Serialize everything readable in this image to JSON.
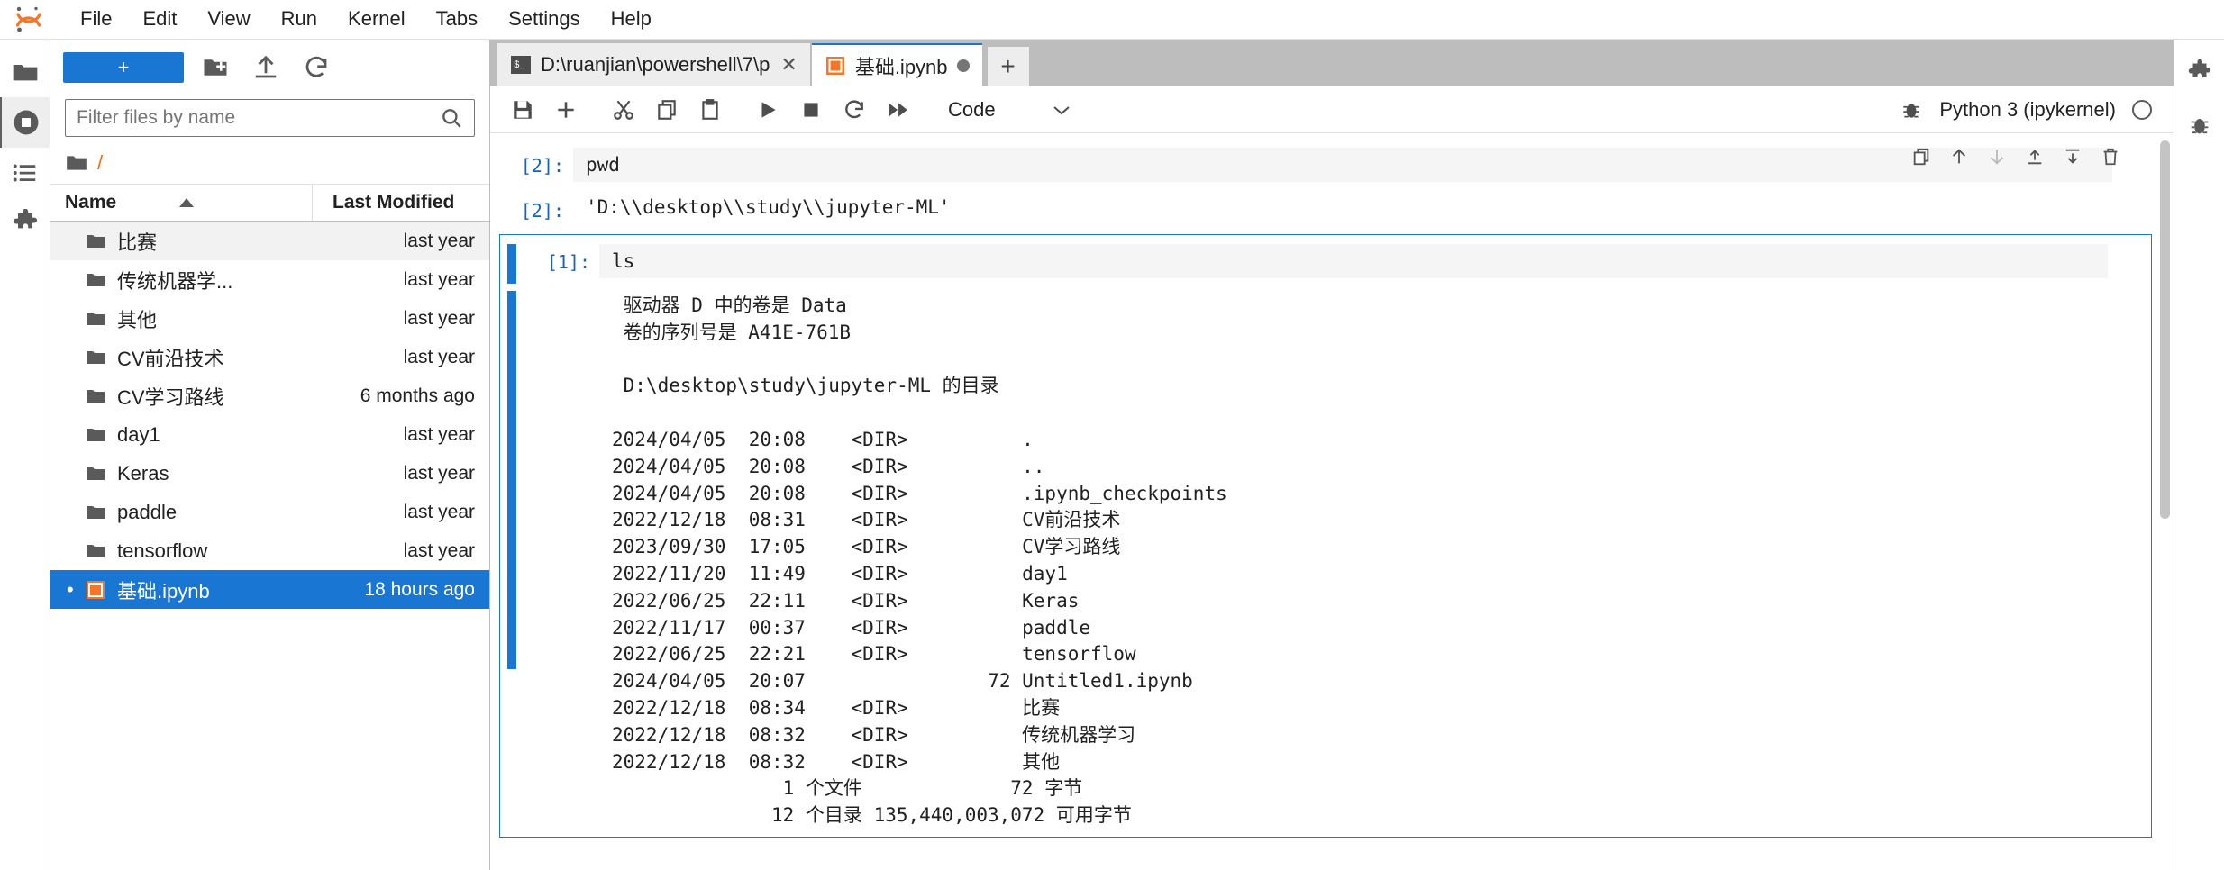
{
  "app": {
    "logo_name": "jupyter-logo",
    "menu": [
      "File",
      "Edit",
      "View",
      "Run",
      "Kernel",
      "Tabs",
      "Settings",
      "Help"
    ]
  },
  "left_activity_bar": {
    "items": [
      {
        "name": "file-browser-icon",
        "label": "File Browser"
      },
      {
        "name": "running-terminals-icon",
        "label": "Running Terminals and Kernels"
      },
      {
        "name": "table-of-contents-icon",
        "label": "Table of Contents"
      },
      {
        "name": "extension-manager-icon",
        "label": "Extension Manager"
      }
    ]
  },
  "file_browser": {
    "new_launcher_label": "+",
    "new_folder_label": "new-folder",
    "upload_label": "upload",
    "refresh_label": "refresh",
    "filter": {
      "value": "",
      "placeholder": "Filter files by name"
    },
    "breadcrumb": "/",
    "columns": {
      "name": "Name",
      "last_modified": "Last Modified"
    },
    "sort_direction": "ascending",
    "items": [
      {
        "name": "比赛",
        "type": "folder",
        "modified": "last year",
        "selected": false
      },
      {
        "name": "传统机器学...",
        "type": "folder",
        "modified": "last year",
        "selected": false
      },
      {
        "name": "其他",
        "type": "folder",
        "modified": "last year",
        "selected": false
      },
      {
        "name": "CV前沿技术",
        "type": "folder",
        "modified": "last year",
        "selected": false
      },
      {
        "name": "CV学习路线",
        "type": "folder",
        "modified": "6 months ago",
        "selected": false
      },
      {
        "name": "day1",
        "type": "folder",
        "modified": "last year",
        "selected": false
      },
      {
        "name": "Keras",
        "type": "folder",
        "modified": "last year",
        "selected": false
      },
      {
        "name": "paddle",
        "type": "folder",
        "modified": "last year",
        "selected": false
      },
      {
        "name": "tensorflow",
        "type": "folder",
        "modified": "last year",
        "selected": false
      },
      {
        "name": "基础.ipynb",
        "type": "notebook",
        "modified": "18 hours ago",
        "selected": true
      }
    ]
  },
  "tabs": [
    {
      "title": "D:\\ruanjian\\powershell\\7\\p",
      "icon": "terminal-icon",
      "active": false,
      "dirty": false,
      "closable": true
    },
    {
      "title": "基础.ipynb",
      "icon": "notebook-icon",
      "active": true,
      "dirty": true,
      "closable": false
    }
  ],
  "tab_add_label": "+",
  "notebook_toolbar": {
    "buttons": [
      {
        "name": "save-button",
        "icon": "save-icon"
      },
      {
        "name": "insert-cell-button",
        "icon": "plus-icon"
      },
      {
        "name": "cut-cell-button",
        "icon": "scissors-icon"
      },
      {
        "name": "copy-cell-button",
        "icon": "copy-icon"
      },
      {
        "name": "paste-cell-button",
        "icon": "paste-icon"
      },
      {
        "name": "run-cell-button",
        "icon": "play-icon"
      },
      {
        "name": "interrupt-kernel-button",
        "icon": "stop-icon"
      },
      {
        "name": "restart-kernel-button",
        "icon": "restart-icon"
      },
      {
        "name": "restart-and-run-all-button",
        "icon": "fast-forward-icon"
      }
    ],
    "cell_type": "Code",
    "kernel_name": "Python 3 (ipykernel)",
    "kernel_status": "idle",
    "bug_icon": "debugger-icon"
  },
  "right_activity_bar": {
    "items": [
      {
        "name": "property-inspector-icon",
        "label": "Property Inspector"
      },
      {
        "name": "debugger-icon",
        "label": "Debugger"
      }
    ]
  },
  "cells": [
    {
      "prompt": "[2]:",
      "type": "input",
      "source": "pwd",
      "selected": false
    },
    {
      "prompt": "[2]:",
      "type": "output",
      "text": "'D:\\\\desktop\\\\study\\\\jupyter-ML'",
      "selected": false
    }
  ],
  "active_cell": {
    "prompt": "[1]:",
    "source": "ls",
    "output": " 驱动器 D 中的卷是 Data\n 卷的序列号是 A41E-761B\n\n D:\\desktop\\study\\jupyter-ML 的目录\n\n2024/04/05  20:08    <DIR>          .\n2024/04/05  20:08    <DIR>          ..\n2024/04/05  20:08    <DIR>          .ipynb_checkpoints\n2022/12/18  08:31    <DIR>          CV前沿技术\n2023/09/30  17:05    <DIR>          CV学习路线\n2022/11/20  11:49    <DIR>          day1\n2022/06/25  22:11    <DIR>          Keras\n2022/11/17  00:37    <DIR>          paddle\n2022/06/25  22:21    <DIR>          tensorflow\n2024/04/05  20:07                72 Untitled1.ipynb\n2022/12/18  08:34    <DIR>          比赛\n2022/12/18  08:32    <DIR>          传统机器学习\n2022/12/18  08:32    <DIR>          其他\n               1 个文件             72 字节\n              12 个目录 135,440,003,072 可用字节",
    "toolbar": [
      {
        "name": "duplicate-cell-button",
        "icon": "copy-icon"
      },
      {
        "name": "move-cell-up-button",
        "icon": "arrow-up-icon"
      },
      {
        "name": "move-cell-down-button",
        "icon": "arrow-down-icon"
      },
      {
        "name": "insert-cell-above-button",
        "icon": "insert-above-icon"
      },
      {
        "name": "insert-cell-below-button",
        "icon": "insert-below-icon"
      },
      {
        "name": "delete-cell-button",
        "icon": "trash-icon"
      }
    ]
  },
  "colors": {
    "accent": "#1976d2",
    "selected_row": "#1976d2",
    "prompt": "#9e9e9e",
    "exec_prompt": "#1565c0",
    "logo_orange": "#e8700f"
  }
}
